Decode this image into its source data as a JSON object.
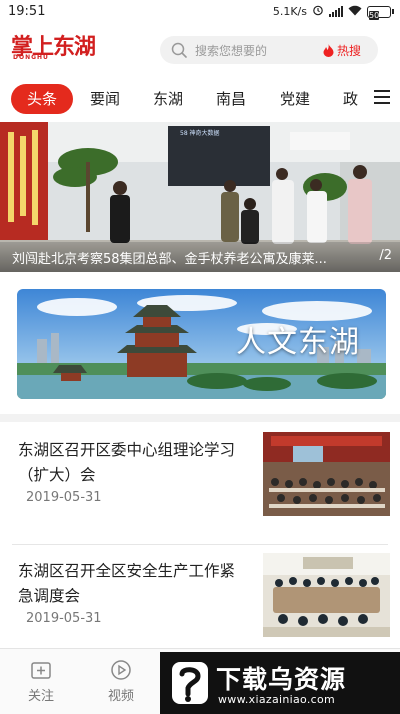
{
  "status_bar": {
    "time": "19:51",
    "network_speed": "5.1K/s",
    "battery": "50"
  },
  "header": {
    "logo_text": "掌上东湖",
    "logo_subtext": "DONGHU",
    "search_placeholder": "搜索您想要的",
    "hot_search_label": "热搜"
  },
  "tabs": [
    {
      "label": "头条",
      "active": true
    },
    {
      "label": "要闻",
      "active": false
    },
    {
      "label": "东湖",
      "active": false
    },
    {
      "label": "南昌",
      "active": false
    },
    {
      "label": "党建",
      "active": false
    },
    {
      "label": "政",
      "active": false
    }
  ],
  "banner": {
    "caption": "刘闯赴北京考察58集团总部、金手杖养老公寓及康莱...",
    "pager": "/2",
    "screen_text": "58 神奇大数据"
  },
  "culture_card": {
    "label": "人文东湖"
  },
  "news": [
    {
      "title": "东湖区召开区委中心组理论学习（扩大）会",
      "date": "2019-05-31"
    },
    {
      "title": "东湖区召开全区安全生产工作紧急调度会",
      "date": "2019-05-31"
    }
  ],
  "bottom_nav": [
    {
      "label": "关注",
      "icon": "plus-square-icon"
    },
    {
      "label": "视频",
      "icon": "play-circle-icon"
    }
  ],
  "promo": {
    "brand": "下载乌资源",
    "url": "www.xiazainiao.com"
  },
  "colors": {
    "accent": "#e42a1d",
    "logo_red": "#d21f1f"
  }
}
